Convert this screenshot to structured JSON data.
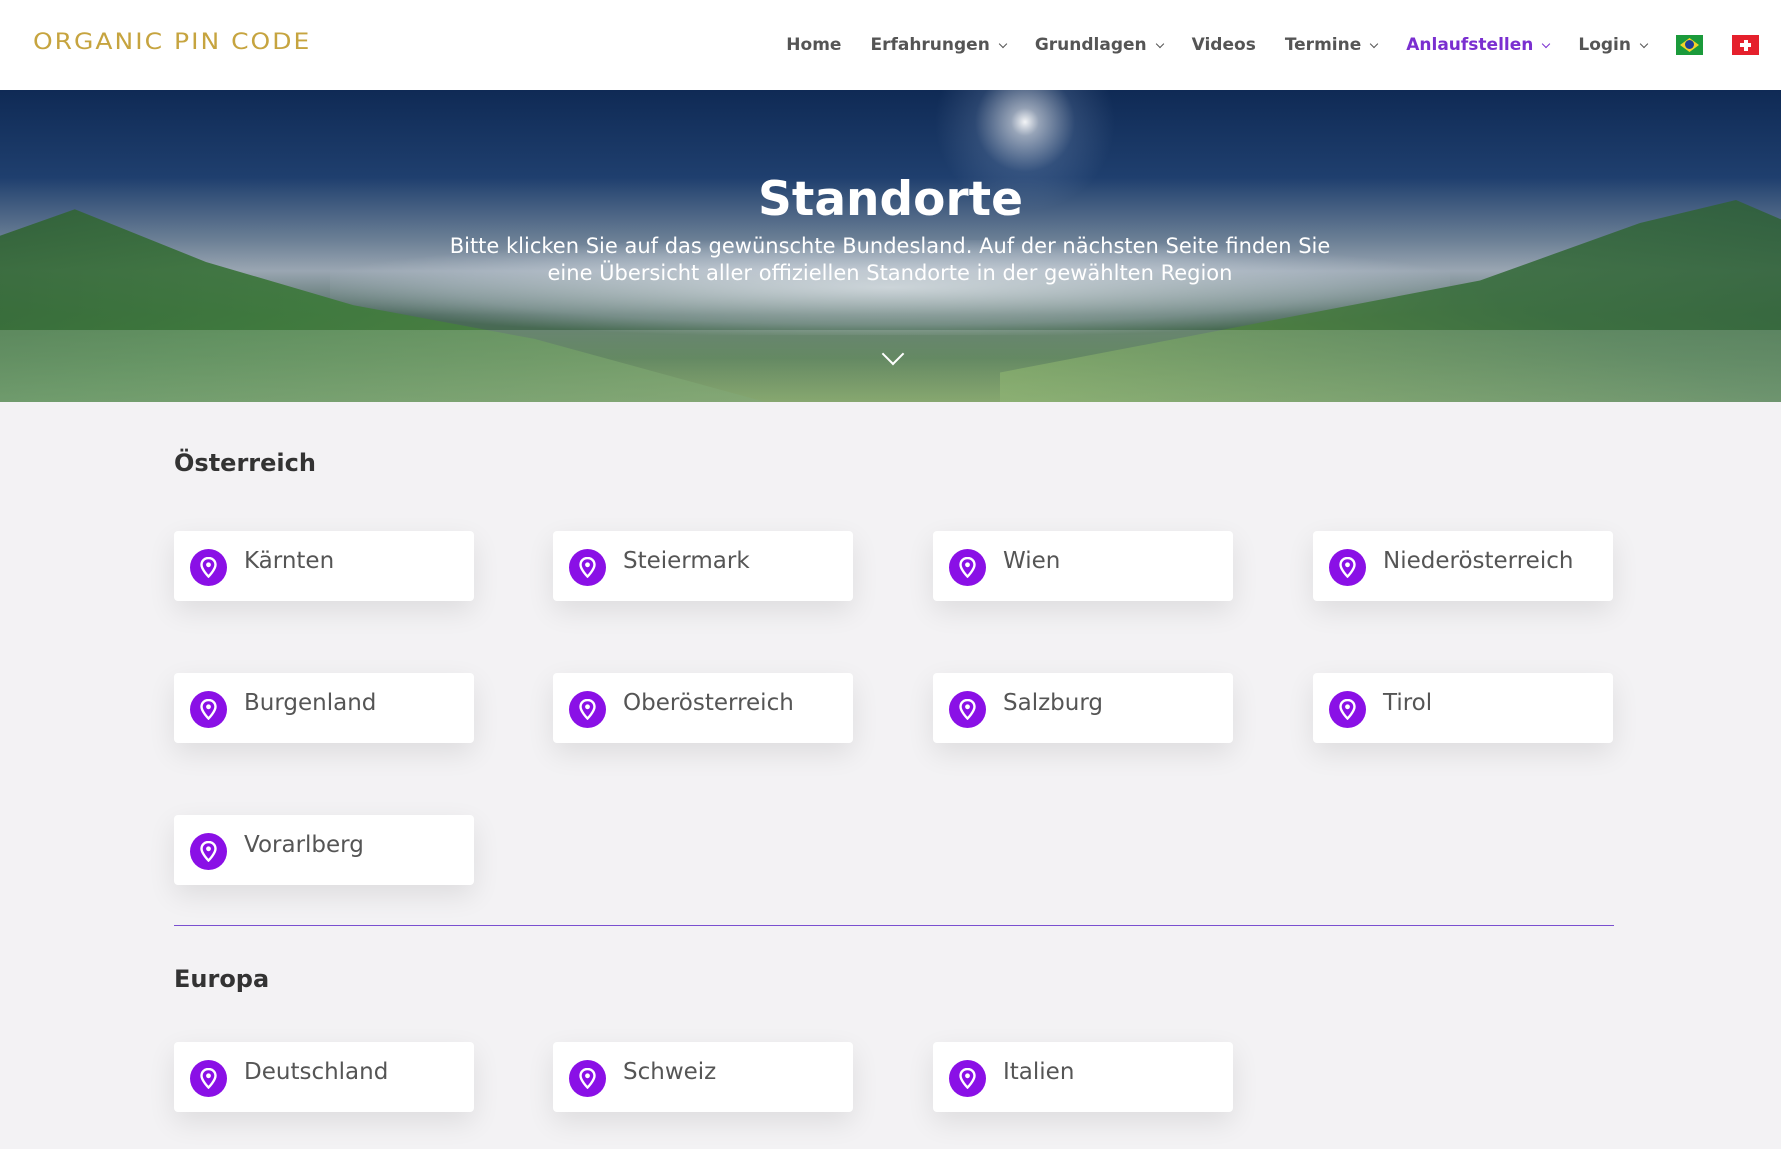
{
  "header": {
    "logo": "ORGANIC PIN CODE",
    "nav": [
      {
        "label": "Home",
        "dropdown": false,
        "active": false
      },
      {
        "label": "Erfahrungen",
        "dropdown": true,
        "active": false
      },
      {
        "label": "Grundlagen",
        "dropdown": true,
        "active": false
      },
      {
        "label": "Videos",
        "dropdown": false,
        "active": false
      },
      {
        "label": "Termine",
        "dropdown": true,
        "active": false
      },
      {
        "label": "Anlaufstellen",
        "dropdown": true,
        "active": true
      },
      {
        "label": "Login",
        "dropdown": true,
        "active": false
      }
    ],
    "flags": [
      "brazil-flag-icon",
      "switzerland-flag-icon"
    ]
  },
  "hero": {
    "title": "Standorte",
    "subtitle_line1": "Bitte klicken Sie auf das gewünschte Bundesland. Auf der nächsten Seite finden Sie",
    "subtitle_line2": "eine Übersicht aller offiziellen Standorte in der gewählten Region"
  },
  "sections": {
    "austria": {
      "title": "Österreich",
      "items": [
        "Kärnten",
        "Steiermark",
        "Wien",
        "Niederösterreich",
        "Burgenland",
        "Oberösterreich",
        "Salzburg",
        "Tirol",
        "Vorarlberg"
      ]
    },
    "europe": {
      "title": "Europa",
      "items": [
        "Deutschland",
        "Schweiz",
        "Italien"
      ]
    }
  },
  "colors": {
    "accent": "#8a10e6",
    "nav_active": "#7a2fd0",
    "logo": "#c6a43f",
    "background": "#f3f2f4"
  },
  "icons": {
    "card_icon": "map-pin-icon",
    "scroll_icon": "chevron-down-icon"
  }
}
